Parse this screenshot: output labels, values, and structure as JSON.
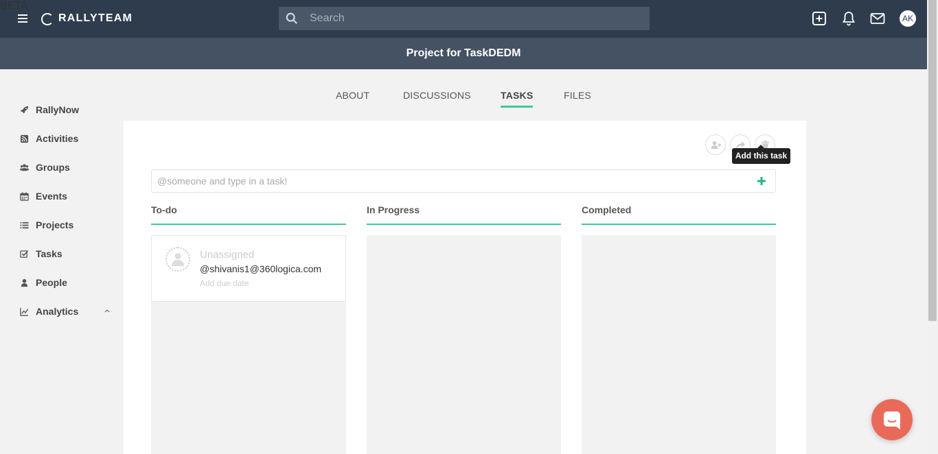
{
  "header": {
    "brand": "RALLYTEAM",
    "brand_tag": "BETA",
    "search_placeholder": "Search",
    "avatar_initials": "AK"
  },
  "project": {
    "title": "Project for TaskDEDM"
  },
  "sidebar": {
    "items": [
      {
        "label": "RallyNow",
        "icon": "rocket-icon"
      },
      {
        "label": "Activities",
        "icon": "feed-icon"
      },
      {
        "label": "Groups",
        "icon": "users-icon"
      },
      {
        "label": "Events",
        "icon": "calendar-icon"
      },
      {
        "label": "Projects",
        "icon": "list-icon"
      },
      {
        "label": "Tasks",
        "icon": "checkbox-icon"
      },
      {
        "label": "People",
        "icon": "user-icon"
      },
      {
        "label": "Analytics",
        "icon": "chart-icon"
      }
    ]
  },
  "tabs": [
    {
      "label": "ABOUT",
      "active": false
    },
    {
      "label": "DISCUSSIONS",
      "active": false
    },
    {
      "label": "TASKS",
      "active": true
    },
    {
      "label": "FILES",
      "active": false
    }
  ],
  "tasks": {
    "input_placeholder": "@someone and type in a task!",
    "tooltip": "Add this task",
    "columns": [
      {
        "label": "To-do"
      },
      {
        "label": "In Progress"
      },
      {
        "label": "Completed"
      }
    ],
    "cards": [
      {
        "assignee": "Unassigned",
        "text": "@shivanis1@360logica.com",
        "due": "Add due date"
      }
    ]
  },
  "colors": {
    "accent": "#3cc7a2",
    "topbar": "#2e3c4e",
    "subheader": "#455264",
    "chat": "#ea6a5a"
  }
}
